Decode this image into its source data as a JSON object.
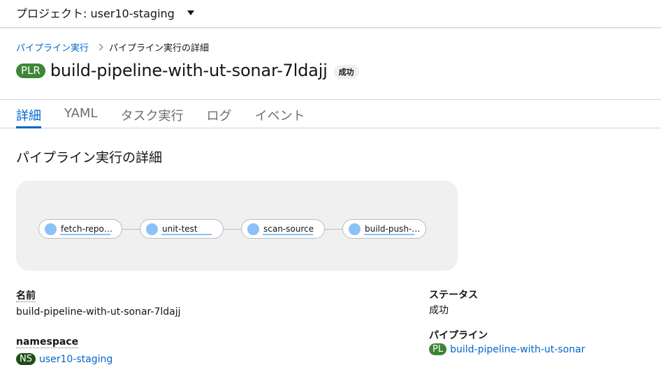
{
  "project_bar": {
    "label": "プロジェクト: user10-staging"
  },
  "breadcrumb": {
    "parent": "パイプライン実行",
    "current": "パイプライン実行の詳細"
  },
  "header": {
    "badge": "PLR",
    "title": "build-pipeline-with-ut-sonar-7ldajj",
    "status": "成功"
  },
  "tabs": [
    {
      "label": "詳細",
      "active": true
    },
    {
      "label": "YAML"
    },
    {
      "label": "タスク実行"
    },
    {
      "label": "ログ"
    },
    {
      "label": "イベント"
    }
  ],
  "section_title": "パイプライン実行の詳細",
  "pipeline_nodes": [
    {
      "label": "fetch-repository"
    },
    {
      "label": "unit-test"
    },
    {
      "label": "scan-source"
    },
    {
      "label": "build-push-image"
    }
  ],
  "details": {
    "name_label": "名前",
    "name_value": "build-pipeline-with-ut-sonar-7ldajj",
    "namespace_label": "namespace",
    "namespace_badge": "NS",
    "namespace_value": "user10-staging",
    "status_label": "ステータス",
    "status_value": "成功",
    "pipeline_label": "パイプライン",
    "pipeline_badge": "PL",
    "pipeline_value": "build-pipeline-with-ut-sonar"
  },
  "colors": {
    "link": "#0066cc",
    "success": "#3e8635",
    "node_dot": "#8bc1f7"
  }
}
